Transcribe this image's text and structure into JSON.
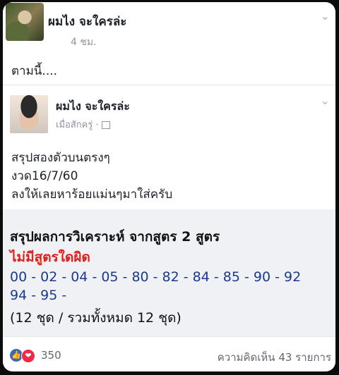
{
  "post": {
    "author": "ผมไง จะใครล่ะ",
    "time": "4 ชม.",
    "text": "ตามนี้...."
  },
  "shared": {
    "author": "ผมไง จะใครล่ะ",
    "time": "เมื่อสักครู่ ·",
    "lines": [
      "สรุปสองตัวบนตรงๆ",
      "งวด16/7/60",
      "ลงให้เลยหาร้อยแม่นๆมาใส่ครับ"
    ]
  },
  "summary": {
    "title": "สรุปผลการวิเคราะห์ จากสูตร 2 สูตร",
    "warning": "ไม่มีสูตรใดผิด",
    "numbers_line1": "00 - 02 - 04 - 05 - 80 - 82 - 84 - 85 - 90 - 92",
    "numbers_line2": "94 - 95 -",
    "count": "(12 ชุด / รวมทั้งหมด 12 ชุด)",
    "warning_color": "#e0201c",
    "numbers_color": "#1b3a8c"
  },
  "footer": {
    "reactions_count": "350",
    "comments": "ความคิดเห็น 43 รายการ",
    "like_icon": "like-icon",
    "love_icon": "love-icon"
  }
}
